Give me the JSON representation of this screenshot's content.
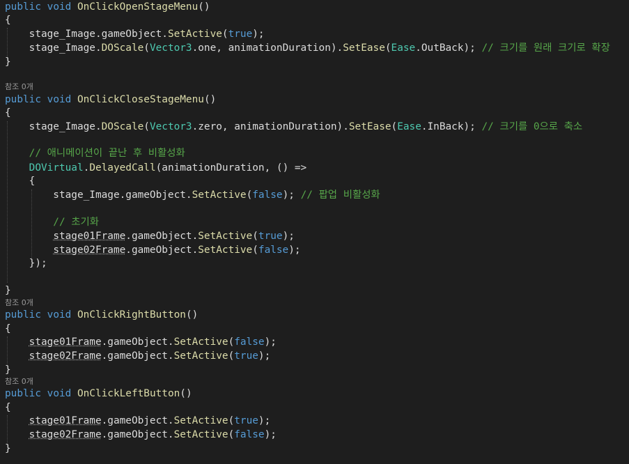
{
  "colors": {
    "background": "#1e1e1e",
    "keyword": "#569cd6",
    "plain": "#dcdcdc",
    "method": "#dcdcaa",
    "type": "#4ec9b0",
    "comment": "#57a64a",
    "codelens": "#999999"
  },
  "codelens": [
    "참조 0개",
    "참조 0개",
    "참조 0개"
  ],
  "lines": [
    [
      [
        "kw",
        "public"
      ],
      [
        "id",
        " "
      ],
      [
        "kw",
        "void"
      ],
      [
        "id",
        " "
      ],
      [
        "fn",
        "OnClickOpenStageMenu"
      ],
      [
        "id",
        "()"
      ]
    ],
    [
      [
        "id",
        "{"
      ]
    ],
    [
      [
        "id",
        "    stage_Image.gameObject."
      ],
      [
        "fn",
        "SetActive"
      ],
      [
        "id",
        "("
      ],
      [
        "kw",
        "true"
      ],
      [
        "id",
        ");"
      ]
    ],
    [
      [
        "id",
        "    stage_Image."
      ],
      [
        "fn",
        "DOScale"
      ],
      [
        "id",
        "("
      ],
      [
        "ty",
        "Vector3"
      ],
      [
        "id",
        ".one, animationDuration)."
      ],
      [
        "fn",
        "SetEase"
      ],
      [
        "id",
        "("
      ],
      [
        "ty",
        "Ease"
      ],
      [
        "id",
        ".OutBack); "
      ],
      [
        "cm",
        "// 크기를 원래 크기로 확장"
      ]
    ],
    [
      [
        "id",
        "}"
      ]
    ],
    [
      [
        "kw",
        "public"
      ],
      [
        "id",
        " "
      ],
      [
        "kw",
        "void"
      ],
      [
        "id",
        " "
      ],
      [
        "fn",
        "OnClickCloseStageMenu"
      ],
      [
        "id",
        "()"
      ]
    ],
    [
      [
        "id",
        "{"
      ]
    ],
    [
      [
        "id",
        "    stage_Image."
      ],
      [
        "fn",
        "DOScale"
      ],
      [
        "id",
        "("
      ],
      [
        "ty",
        "Vector3"
      ],
      [
        "id",
        ".zero, animationDuration)."
      ],
      [
        "fn",
        "SetEase"
      ],
      [
        "id",
        "("
      ],
      [
        "ty",
        "Ease"
      ],
      [
        "id",
        ".InBack); "
      ],
      [
        "cm",
        "// 크기를 0으로 축소"
      ]
    ],
    [
      [
        "cm",
        "    // 애니메이션이 끝난 후 비활성화"
      ]
    ],
    [
      [
        "id",
        "    "
      ],
      [
        "ty",
        "DOVirtual"
      ],
      [
        "id",
        "."
      ],
      [
        "fn",
        "DelayedCall"
      ],
      [
        "id",
        "(animationDuration, () =>"
      ]
    ],
    [
      [
        "id",
        "    {"
      ]
    ],
    [
      [
        "id",
        "        stage_Image.gameObject."
      ],
      [
        "fn",
        "SetActive"
      ],
      [
        "id",
        "("
      ],
      [
        "kw",
        "false"
      ],
      [
        "id",
        "); "
      ],
      [
        "cm",
        "// 팝업 비활성화"
      ]
    ],
    [
      [
        "cm",
        "        // 초기화"
      ]
    ],
    [
      [
        "id",
        "        "
      ],
      [
        "sq",
        "stage01Frame"
      ],
      [
        "id",
        ".gameObject."
      ],
      [
        "fn",
        "SetActive"
      ],
      [
        "id",
        "("
      ],
      [
        "kw",
        "true"
      ],
      [
        "id",
        ");"
      ]
    ],
    [
      [
        "id",
        "        "
      ],
      [
        "sq",
        "stage02Frame"
      ],
      [
        "id",
        ".gameObject."
      ],
      [
        "fn",
        "SetActive"
      ],
      [
        "id",
        "("
      ],
      [
        "kw",
        "false"
      ],
      [
        "id",
        ");"
      ]
    ],
    [
      [
        "id",
        "    });"
      ]
    ],
    [
      [
        "id",
        "}"
      ]
    ],
    [
      [
        "kw",
        "public"
      ],
      [
        "id",
        " "
      ],
      [
        "kw",
        "void"
      ],
      [
        "id",
        " "
      ],
      [
        "fn",
        "OnClickRightButton"
      ],
      [
        "id",
        "()"
      ]
    ],
    [
      [
        "id",
        "{"
      ]
    ],
    [
      [
        "id",
        "    "
      ],
      [
        "sq",
        "stage01Frame"
      ],
      [
        "id",
        ".gameObject."
      ],
      [
        "fn",
        "SetActive"
      ],
      [
        "id",
        "("
      ],
      [
        "kw",
        "false"
      ],
      [
        "id",
        ");"
      ]
    ],
    [
      [
        "id",
        "    "
      ],
      [
        "sq",
        "stage02Frame"
      ],
      [
        "id",
        ".gameObject."
      ],
      [
        "fn",
        "SetActive"
      ],
      [
        "id",
        "("
      ],
      [
        "kw",
        "true"
      ],
      [
        "id",
        ");"
      ]
    ],
    [
      [
        "id",
        "}"
      ]
    ],
    [
      [
        "kw",
        "public"
      ],
      [
        "id",
        " "
      ],
      [
        "kw",
        "void"
      ],
      [
        "id",
        " "
      ],
      [
        "fn",
        "OnClickLeftButton"
      ],
      [
        "id",
        "()"
      ]
    ],
    [
      [
        "id",
        "{"
      ]
    ],
    [
      [
        "id",
        "    "
      ],
      [
        "sq",
        "stage01Frame"
      ],
      [
        "id",
        ".gameObject."
      ],
      [
        "fn",
        "SetActive"
      ],
      [
        "id",
        "("
      ],
      [
        "kw",
        "true"
      ],
      [
        "id",
        ");"
      ]
    ],
    [
      [
        "id",
        "    "
      ],
      [
        "sq",
        "stage02Frame"
      ],
      [
        "id",
        ".gameObject."
      ],
      [
        "fn",
        "SetActive"
      ],
      [
        "id",
        "("
      ],
      [
        "kw",
        "false"
      ],
      [
        "id",
        ");"
      ]
    ],
    [
      [
        "id",
        "}"
      ]
    ]
  ]
}
